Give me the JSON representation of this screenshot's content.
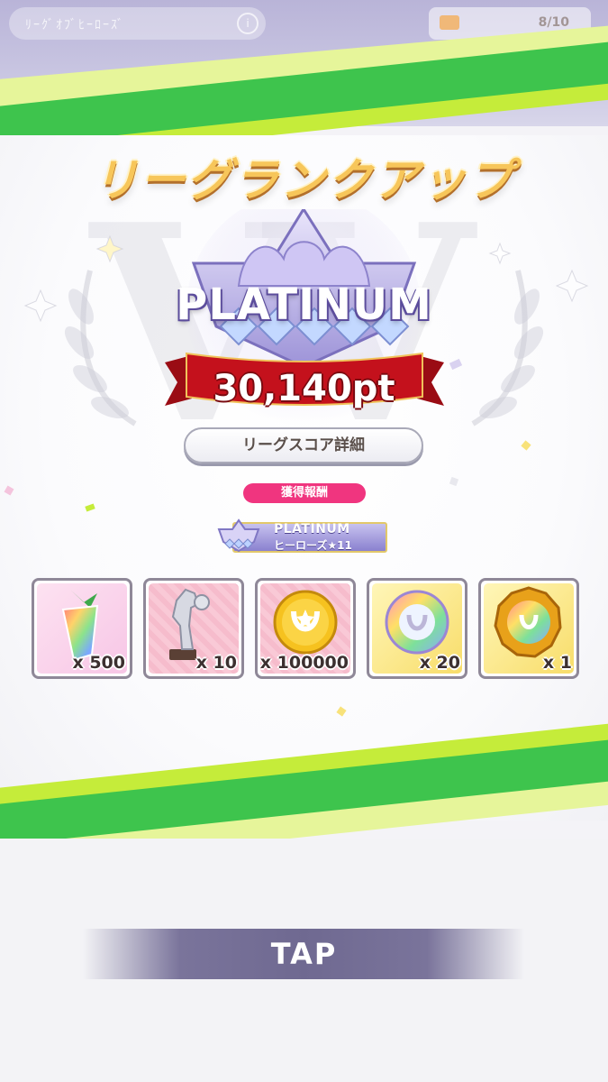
{
  "header": {
    "left_label": "ﾘｰｸﾞｵﾌﾞﾋｰﾛｰｽﾞ",
    "info_icon": "info-icon",
    "right_count": "8/10"
  },
  "title": "リーグランクアップ",
  "rank": {
    "name": "PLATINUM",
    "points": "30,140pt"
  },
  "score_button": "リーグスコア詳細",
  "reward_heading": "獲得報酬",
  "title_reward": {
    "line1": "PLATINUM",
    "line2": "ヒーローズ★11"
  },
  "rewards": [
    {
      "icon": "rainbow-carrot-icon",
      "qty": "x 500"
    },
    {
      "icon": "horse-statue-icon",
      "qty": "x 10"
    },
    {
      "icon": "gold-coin-icon",
      "qty": "x 100000"
    },
    {
      "icon": "rainbow-horseshoe-ring-icon",
      "qty": "x 20"
    },
    {
      "icon": "gold-medal-icon",
      "qty": "x 1"
    }
  ],
  "tap": "TAP",
  "colors": {
    "green": "#3ec44d",
    "lime": "#c5ec3a",
    "ribbon_red": "#c4111c",
    "title_gold": "#f7c65a",
    "reward_pink": "#f0357f"
  }
}
